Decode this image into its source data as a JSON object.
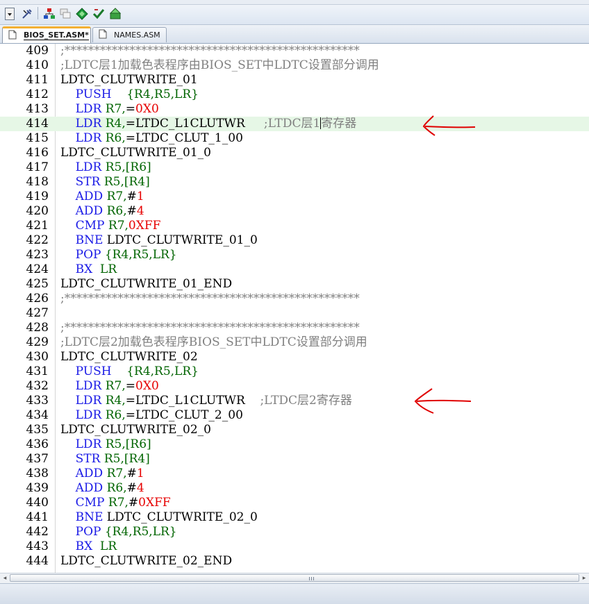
{
  "toolbar": {
    "buttons": [
      {
        "icon": "dropdown-icon"
      },
      {
        "icon": "tools-icon"
      },
      {
        "icon": "hierarchy-icon"
      },
      {
        "icon": "windows-icon"
      },
      {
        "icon": "diamond-icon"
      },
      {
        "icon": "check-icon"
      },
      {
        "icon": "build-icon"
      }
    ]
  },
  "tabs": [
    {
      "label": "BIOS_SET.ASM*",
      "active": true
    },
    {
      "label": "NAMES.ASM",
      "active": false
    }
  ],
  "editor": {
    "current_line": 414,
    "lines": [
      {
        "n": "409",
        "segs": [
          {
            "t": ";**************************************************",
            "c": "cm"
          }
        ]
      },
      {
        "n": "410",
        "segs": [
          {
            "t": ";LDTC层1加载色表程序由BIOS_SET中LDTC设置部分调用",
            "c": "cm"
          }
        ]
      },
      {
        "n": "411",
        "segs": [
          {
            "t": "LDTC_CLUTWRITE_01",
            "c": ""
          }
        ]
      },
      {
        "n": "412",
        "segs": [
          {
            "t": "    ",
            "c": ""
          },
          {
            "t": "PUSH",
            "c": "kw"
          },
          {
            "t": "    ",
            "c": ""
          },
          {
            "t": "{R4,R5,LR}",
            "c": "op"
          }
        ]
      },
      {
        "n": "413",
        "segs": [
          {
            "t": "    ",
            "c": ""
          },
          {
            "t": "LDR",
            "c": "kw"
          },
          {
            "t": " ",
            "c": ""
          },
          {
            "t": "R7,",
            "c": "op"
          },
          {
            "t": "=",
            "c": ""
          },
          {
            "t": "0X0",
            "c": "nm"
          }
        ]
      },
      {
        "n": "414",
        "segs": [
          {
            "t": "    ",
            "c": ""
          },
          {
            "t": "LDR",
            "c": "kw"
          },
          {
            "t": " ",
            "c": ""
          },
          {
            "t": "R4,",
            "c": "op"
          },
          {
            "t": "=LTDC_L1CLUTWR     ",
            "c": ""
          },
          {
            "t": ";LTDC层1",
            "c": "cm"
          },
          {
            "t": "寄存器",
            "c": "cm"
          }
        ]
      },
      {
        "n": "415",
        "segs": [
          {
            "t": "    ",
            "c": ""
          },
          {
            "t": "LDR",
            "c": "kw"
          },
          {
            "t": " ",
            "c": ""
          },
          {
            "t": "R6,",
            "c": "op"
          },
          {
            "t": "=LTDC_CLUT_1_00",
            "c": ""
          }
        ]
      },
      {
        "n": "416",
        "segs": [
          {
            "t": "LDTC_CLUTWRITE_01_0",
            "c": ""
          }
        ]
      },
      {
        "n": "417",
        "segs": [
          {
            "t": "    ",
            "c": ""
          },
          {
            "t": "LDR",
            "c": "kw"
          },
          {
            "t": " ",
            "c": ""
          },
          {
            "t": "R5,[R6]",
            "c": "op"
          }
        ]
      },
      {
        "n": "418",
        "segs": [
          {
            "t": "    ",
            "c": ""
          },
          {
            "t": "STR",
            "c": "kw"
          },
          {
            "t": " ",
            "c": ""
          },
          {
            "t": "R5,[R4]",
            "c": "op"
          }
        ]
      },
      {
        "n": "419",
        "segs": [
          {
            "t": "    ",
            "c": ""
          },
          {
            "t": "ADD",
            "c": "kw"
          },
          {
            "t": " ",
            "c": ""
          },
          {
            "t": "R7,",
            "c": "op"
          },
          {
            "t": "#",
            "c": ""
          },
          {
            "t": "1",
            "c": "nm"
          }
        ]
      },
      {
        "n": "420",
        "segs": [
          {
            "t": "    ",
            "c": ""
          },
          {
            "t": "ADD",
            "c": "kw"
          },
          {
            "t": " ",
            "c": ""
          },
          {
            "t": "R6,",
            "c": "op"
          },
          {
            "t": "#",
            "c": ""
          },
          {
            "t": "4",
            "c": "nm"
          }
        ]
      },
      {
        "n": "421",
        "segs": [
          {
            "t": "    ",
            "c": ""
          },
          {
            "t": "CMP",
            "c": "kw"
          },
          {
            "t": " ",
            "c": ""
          },
          {
            "t": "R7,",
            "c": "op"
          },
          {
            "t": "0XFF",
            "c": "nm"
          }
        ]
      },
      {
        "n": "422",
        "segs": [
          {
            "t": "    ",
            "c": ""
          },
          {
            "t": "BNE",
            "c": "kw"
          },
          {
            "t": " LDTC_CLUTWRITE_01_0",
            "c": ""
          }
        ]
      },
      {
        "n": "423",
        "segs": [
          {
            "t": "    ",
            "c": ""
          },
          {
            "t": "POP",
            "c": "kw"
          },
          {
            "t": " ",
            "c": ""
          },
          {
            "t": "{R4,R5,LR}",
            "c": "op"
          }
        ]
      },
      {
        "n": "424",
        "segs": [
          {
            "t": "    ",
            "c": ""
          },
          {
            "t": "BX",
            "c": "kw"
          },
          {
            "t": "  ",
            "c": ""
          },
          {
            "t": "LR",
            "c": "op"
          }
        ]
      },
      {
        "n": "425",
        "segs": [
          {
            "t": "LDTC_CLUTWRITE_01_END",
            "c": ""
          }
        ]
      },
      {
        "n": "426",
        "segs": [
          {
            "t": ";**************************************************",
            "c": "cm"
          }
        ]
      },
      {
        "n": "427",
        "segs": []
      },
      {
        "n": "428",
        "segs": [
          {
            "t": ";**************************************************",
            "c": "cm"
          }
        ]
      },
      {
        "n": "429",
        "segs": [
          {
            "t": ";LDTC层2加载色表程序BIOS_SET中LDTC设置部分调用",
            "c": "cm"
          }
        ]
      },
      {
        "n": "430",
        "segs": [
          {
            "t": "LDTC_CLUTWRITE_02",
            "c": ""
          }
        ]
      },
      {
        "n": "431",
        "segs": [
          {
            "t": "    ",
            "c": ""
          },
          {
            "t": "PUSH",
            "c": "kw"
          },
          {
            "t": "    ",
            "c": ""
          },
          {
            "t": "{R4,R5,LR}",
            "c": "op"
          }
        ]
      },
      {
        "n": "432",
        "segs": [
          {
            "t": "    ",
            "c": ""
          },
          {
            "t": "LDR",
            "c": "kw"
          },
          {
            "t": " ",
            "c": ""
          },
          {
            "t": "R7,",
            "c": "op"
          },
          {
            "t": "=",
            "c": ""
          },
          {
            "t": "0X0",
            "c": "nm"
          }
        ]
      },
      {
        "n": "433",
        "segs": [
          {
            "t": "    ",
            "c": ""
          },
          {
            "t": "LDR",
            "c": "kw"
          },
          {
            "t": " ",
            "c": ""
          },
          {
            "t": "R4,",
            "c": "op"
          },
          {
            "t": "=LTDC_L1CLUTWR    ",
            "c": ""
          },
          {
            "t": ";LTDC层2寄存器",
            "c": "cm"
          }
        ]
      },
      {
        "n": "434",
        "segs": [
          {
            "t": "    ",
            "c": ""
          },
          {
            "t": "LDR",
            "c": "kw"
          },
          {
            "t": " ",
            "c": ""
          },
          {
            "t": "R6,",
            "c": "op"
          },
          {
            "t": "=LTDC_CLUT_2_00",
            "c": ""
          }
        ]
      },
      {
        "n": "435",
        "segs": [
          {
            "t": "LDTC_CLUTWRITE_02_0",
            "c": ""
          }
        ]
      },
      {
        "n": "436",
        "segs": [
          {
            "t": "    ",
            "c": ""
          },
          {
            "t": "LDR",
            "c": "kw"
          },
          {
            "t": " ",
            "c": ""
          },
          {
            "t": "R5,[R6]",
            "c": "op"
          }
        ]
      },
      {
        "n": "437",
        "segs": [
          {
            "t": "    ",
            "c": ""
          },
          {
            "t": "STR",
            "c": "kw"
          },
          {
            "t": " ",
            "c": ""
          },
          {
            "t": "R5,[R4]",
            "c": "op"
          }
        ]
      },
      {
        "n": "438",
        "segs": [
          {
            "t": "    ",
            "c": ""
          },
          {
            "t": "ADD",
            "c": "kw"
          },
          {
            "t": " ",
            "c": ""
          },
          {
            "t": "R7,",
            "c": "op"
          },
          {
            "t": "#",
            "c": ""
          },
          {
            "t": "1",
            "c": "nm"
          }
        ]
      },
      {
        "n": "439",
        "segs": [
          {
            "t": "    ",
            "c": ""
          },
          {
            "t": "ADD",
            "c": "kw"
          },
          {
            "t": " ",
            "c": ""
          },
          {
            "t": "R6,",
            "c": "op"
          },
          {
            "t": "#",
            "c": ""
          },
          {
            "t": "4",
            "c": "nm"
          }
        ]
      },
      {
        "n": "440",
        "segs": [
          {
            "t": "    ",
            "c": ""
          },
          {
            "t": "CMP",
            "c": "kw"
          },
          {
            "t": " ",
            "c": ""
          },
          {
            "t": "R7,",
            "c": "op"
          },
          {
            "t": "#",
            "c": ""
          },
          {
            "t": "0XFF",
            "c": "nm"
          }
        ]
      },
      {
        "n": "441",
        "segs": [
          {
            "t": "    ",
            "c": ""
          },
          {
            "t": "BNE",
            "c": "kw"
          },
          {
            "t": " LDTC_CLUTWRITE_02_0",
            "c": ""
          }
        ]
      },
      {
        "n": "442",
        "segs": [
          {
            "t": "    ",
            "c": ""
          },
          {
            "t": "POP",
            "c": "kw"
          },
          {
            "t": " ",
            "c": ""
          },
          {
            "t": "{R4,R5,LR}",
            "c": "op"
          }
        ]
      },
      {
        "n": "443",
        "segs": [
          {
            "t": "    ",
            "c": ""
          },
          {
            "t": "BX",
            "c": "kw"
          },
          {
            "t": "  ",
            "c": ""
          },
          {
            "t": "LR",
            "c": "op"
          }
        ]
      },
      {
        "n": "444",
        "segs": [
          {
            "t": "LDTC_CLUTWRITE_02_END",
            "c": ""
          }
        ]
      }
    ]
  },
  "colors": {
    "keyword": "#1a1ae6",
    "operand": "#006400",
    "number": "#e60000",
    "comment": "#808080",
    "current_line": "#e6f7e6",
    "annotation_arrow": "#e00000"
  },
  "annotations": [
    {
      "icon": "red-arrow-icon",
      "points_to_line": 414
    },
    {
      "icon": "red-arrow-icon",
      "points_to_line": 433
    }
  ]
}
